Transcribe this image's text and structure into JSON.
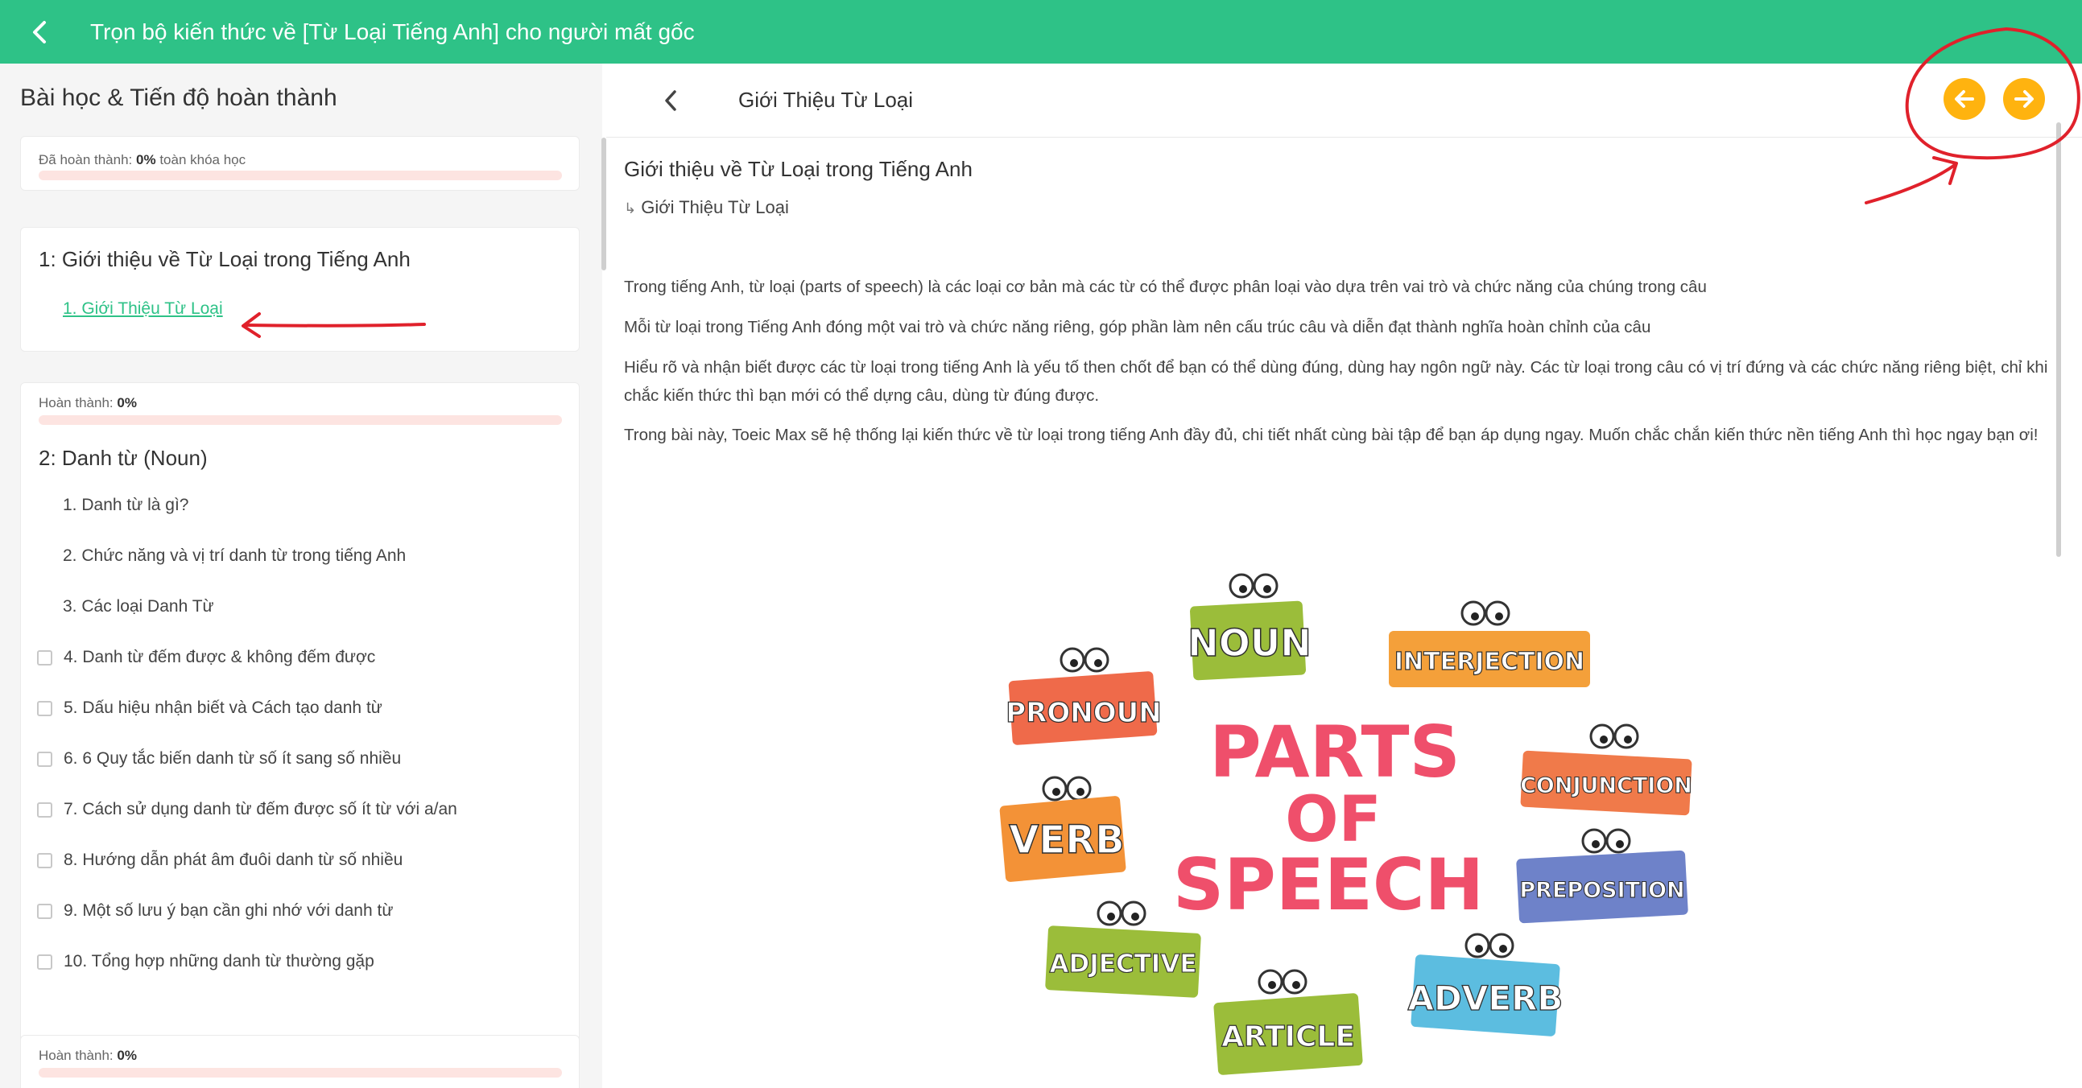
{
  "header": {
    "title": "Trọn bộ kiến thức về [Từ Loại Tiếng Anh] cho người mất gốc"
  },
  "sidebar": {
    "heading": "Bài học & Tiến độ hoàn thành",
    "overall": {
      "label": "Đã hoàn thành:",
      "value": "0%",
      "suffix": "toàn khóa học",
      "progress": 0
    },
    "sections": [
      {
        "title": "1: Giới thiệu về Từ Loại trong Tiếng Anh",
        "lessons": [
          {
            "label": "1. Giới Thiệu Từ Loại",
            "active": true
          }
        ]
      },
      {
        "progress_label": "Hoàn thành:",
        "progress_value": "0%",
        "progress": 0,
        "title": "2: Danh từ (Noun)",
        "lessons": [
          {
            "label": "1. Danh từ là gì?"
          },
          {
            "label": "2. Chức năng và vị trí danh từ trong tiếng Anh"
          },
          {
            "label": "3. Các loại Danh Từ"
          },
          {
            "label": "4. Danh từ đếm được & không đếm được"
          },
          {
            "label": "5. Dấu hiệu nhận biết và Cách tạo danh từ"
          },
          {
            "label": "6. 6 Quy tắc biến danh từ số ít sang số nhiều"
          },
          {
            "label": "7. Cách sử dụng danh từ đếm được số ít từ với a/an"
          },
          {
            "label": "8. Hướng dẫn phát âm đuôi danh từ số nhiều"
          },
          {
            "label": "9. Một số lưu ý bạn cần ghi nhớ với danh từ"
          },
          {
            "label": "10. Tổng hợp những danh từ thường gặp"
          }
        ]
      },
      {
        "progress_label": "Hoàn thành:",
        "progress_value": "0%",
        "progress": 0
      }
    ]
  },
  "content": {
    "header_title": "Giới Thiệu Từ Loại",
    "title": "Giới thiệu về Từ Loại trong Tiếng Anh",
    "subtitle": "Giới Thiệu Từ Loại",
    "paragraphs": [
      "Trong tiếng Anh, từ loại (parts of speech) là các loại cơ bản mà các từ có thể được phân loại vào dựa trên vai trò và chức năng của chúng trong câu",
      "Mỗi từ loại trong Tiếng Anh đóng một vai trò và chức năng riêng, góp phần làm nên cấu trúc câu và diễn đạt thành nghĩa hoàn chỉnh của câu",
      "Hiểu rõ và nhận biết được các từ loại trong tiếng Anh là yếu tố then chốt để bạn có thể dùng đúng, dùng hay ngôn ngữ này. Các từ loại trong câu có vị trí đứng và các chức năng riêng biệt, chỉ khi chắc kiến thức thì bạn mới có thể dựng câu, dùng từ đúng được.",
      "Trong bài này, Toeic Max sẽ hệ thống lại kiến thức về từ loại trong tiếng Anh đầy đủ, chi tiết nhất cùng bài tập để bạn áp dụng ngay. Muốn chắc chắn kiến thức nền tiếng Anh thì học ngay bạn ơi!"
    ],
    "illustration": {
      "center_lines": [
        "PARTS",
        "OF",
        "SPEECH"
      ],
      "labels": [
        "NOUN",
        "INTERJECTION",
        "PRONOUN",
        "CONJUNCTION",
        "VERB",
        "PREPOSITION",
        "ADJECTIVE",
        "ADVERB",
        "ARTICLE"
      ]
    }
  },
  "colors": {
    "brand_green": "#2ec287",
    "nav_button": "#ffb30f",
    "progress_track": "#fde4e1",
    "annotation_red": "#e0212b"
  },
  "icons": {
    "back": "chevron-left-icon",
    "prev": "arrow-left-icon",
    "next": "arrow-right-icon",
    "sub": "subdirectory-arrow-icon"
  }
}
